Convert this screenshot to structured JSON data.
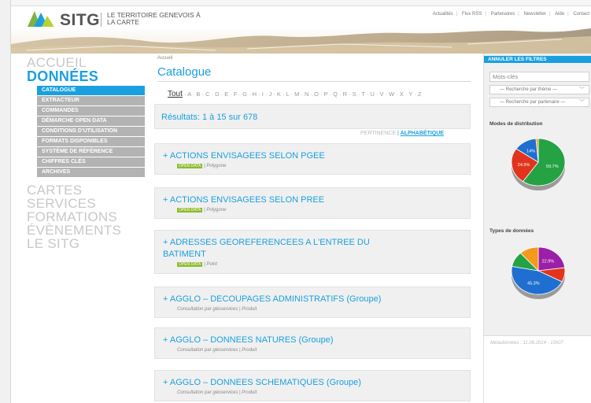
{
  "header": {
    "logo_text": "SITG",
    "tagline": "LE TERRITOIRE GENEVOIS À LA CARTE",
    "topnav": [
      "Actualités",
      "Flux RSS",
      "Partenaires",
      "Newsletter",
      "Aide",
      "Contact"
    ]
  },
  "sidebar": {
    "accueil": "ACCUEIL",
    "donnees": "DONNÉES",
    "subitems": [
      "CATALOGUE",
      "EXTRACTEUR",
      "COMMANDES",
      "DÉMARCHE OPEN DATA",
      "CONDITIONS D'UTILISATION",
      "FORMATS DISPONIBLES",
      "SYSTÈME DE RÉFÉRENCE",
      "CHIFFRES CLÉS",
      "ARCHIVES"
    ],
    "lower": [
      "CARTES",
      "SERVICES",
      "FORMATIONS",
      "ÉVÈNEMENTS",
      "LE SITG"
    ]
  },
  "main": {
    "breadcrumb": "Accueil",
    "title": "Catalogue",
    "alpha_all": "Tout",
    "alpha_letters": "· A · B · C · D · E · F · G · H · I · J · K · L · M · N · O · P · Q · R · S · T · U · V · W · X · Y · Z",
    "results": "Résultats: 1 à 15 sur 678",
    "sort_pertinence": "PERTINENCE",
    "sort_sep": "|",
    "sort_alpha": "ALPHABÉTIQUE",
    "open_badge": "OPEN DATA",
    "items": [
      {
        "title": "+ ACTIONS ENVISAGEES SELON PGEE",
        "meta": "| Polygone"
      },
      {
        "title": "+ ACTIONS ENVISAGEES SELON PREE",
        "meta": "| Polygone"
      },
      {
        "title": "+ ADRESSES GEOREFERENCEES A L'ENTREE DU BATIMENT",
        "meta": "| Point"
      },
      {
        "title": "+ AGGLO – DECOUPAGES ADMINISTRATIFS (Groupe)",
        "meta": "Consultation par géoservices | Produit"
      },
      {
        "title": "+ AGGLO – DONNEES NATURES (Groupe)",
        "meta": "Consultation par géoservices | Produit"
      },
      {
        "title": "+ AGGLO – DONNEES SCHEMATIQUES (Groupe)",
        "meta": "Consultation par géoservices | Produit"
      }
    ]
  },
  "right_panel": {
    "clear_filters": "ANNULER LES FILTRES",
    "keywords_placeholder": "Mots-clés",
    "theme_select": "— Recherche par thème —",
    "partner_select": "— Recherche par partenaire —",
    "dist_label": "Modes de distribution",
    "types_label": "Types de données",
    "metadata_footer": "Métadonnées : 11.06.2014 - 15h07"
  },
  "chart_data": [
    {
      "type": "pie",
      "title": "Modes de distribution",
      "labels": [
        "59.7%",
        "24.9%",
        "14%"
      ],
      "values": [
        59.7,
        24.9,
        14.0,
        1.4
      ],
      "colors": [
        "#25a244",
        "#e2341d",
        "#1f6fd0",
        "#f39a1b"
      ]
    },
    {
      "type": "pie",
      "title": "Types de données",
      "labels": [
        "22.9%",
        "45.3%"
      ],
      "values": [
        22.9,
        9.8,
        45.3,
        10.5,
        11.5
      ],
      "colors": [
        "#9b1fa8",
        "#e2341d",
        "#1f6fd0",
        "#25a244",
        "#f39a1b"
      ]
    }
  ],
  "colors": {
    "accent": "#1aa0de",
    "menu_grey": "#b3b3b3",
    "open_data_green": "#8dbb2c"
  }
}
